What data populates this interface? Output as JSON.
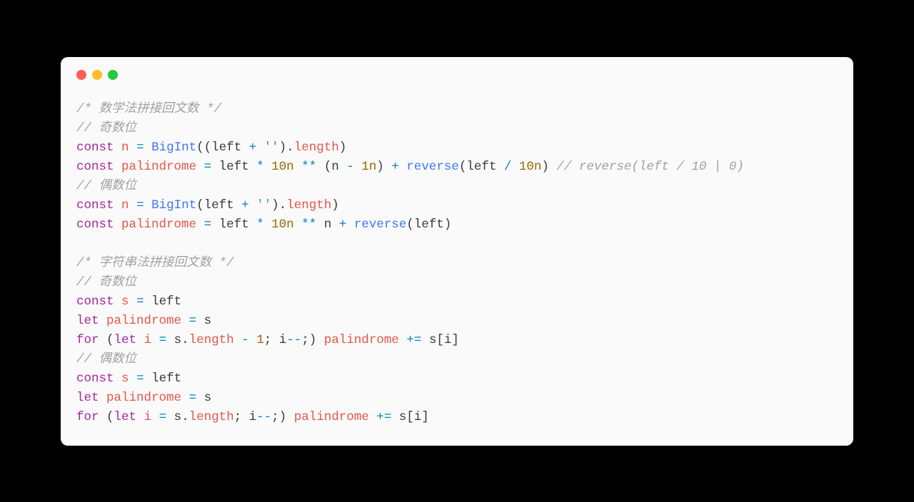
{
  "window": {
    "traffic_lights": [
      "red",
      "yellow",
      "green"
    ]
  },
  "code": {
    "lines": [
      [
        {
          "cls": "tok-comment",
          "t": "/* 数学法拼接回文数 */"
        }
      ],
      [
        {
          "cls": "tok-comment",
          "t": "// 奇数位"
        }
      ],
      [
        {
          "cls": "tok-keyword",
          "t": "const"
        },
        {
          "cls": "tok-plain",
          "t": " "
        },
        {
          "cls": "tok-var",
          "t": "n"
        },
        {
          "cls": "tok-plain",
          "t": " "
        },
        {
          "cls": "tok-op",
          "t": "="
        },
        {
          "cls": "tok-plain",
          "t": " "
        },
        {
          "cls": "tok-func",
          "t": "BigInt"
        },
        {
          "cls": "tok-plain",
          "t": "((left "
        },
        {
          "cls": "tok-op",
          "t": "+"
        },
        {
          "cls": "tok-plain",
          "t": " "
        },
        {
          "cls": "tok-string",
          "t": "''"
        },
        {
          "cls": "tok-plain",
          "t": ")."
        },
        {
          "cls": "tok-prop",
          "t": "length"
        },
        {
          "cls": "tok-plain",
          "t": ")"
        }
      ],
      [
        {
          "cls": "tok-keyword",
          "t": "const"
        },
        {
          "cls": "tok-plain",
          "t": " "
        },
        {
          "cls": "tok-var",
          "t": "palindrome"
        },
        {
          "cls": "tok-plain",
          "t": " "
        },
        {
          "cls": "tok-op",
          "t": "="
        },
        {
          "cls": "tok-plain",
          "t": " left "
        },
        {
          "cls": "tok-op",
          "t": "*"
        },
        {
          "cls": "tok-plain",
          "t": " "
        },
        {
          "cls": "tok-num",
          "t": "10n"
        },
        {
          "cls": "tok-plain",
          "t": " "
        },
        {
          "cls": "tok-op",
          "t": "**"
        },
        {
          "cls": "tok-plain",
          "t": " (n "
        },
        {
          "cls": "tok-op",
          "t": "-"
        },
        {
          "cls": "tok-plain",
          "t": " "
        },
        {
          "cls": "tok-num",
          "t": "1n"
        },
        {
          "cls": "tok-plain",
          "t": ") "
        },
        {
          "cls": "tok-op",
          "t": "+"
        },
        {
          "cls": "tok-plain",
          "t": " "
        },
        {
          "cls": "tok-func",
          "t": "reverse"
        },
        {
          "cls": "tok-plain",
          "t": "(left "
        },
        {
          "cls": "tok-op",
          "t": "/"
        },
        {
          "cls": "tok-plain",
          "t": " "
        },
        {
          "cls": "tok-num",
          "t": "10n"
        },
        {
          "cls": "tok-plain",
          "t": ") "
        },
        {
          "cls": "tok-comment",
          "t": "// reverse(left / 10 | 0)"
        }
      ],
      [
        {
          "cls": "tok-comment",
          "t": "// 偶数位"
        }
      ],
      [
        {
          "cls": "tok-keyword",
          "t": "const"
        },
        {
          "cls": "tok-plain",
          "t": " "
        },
        {
          "cls": "tok-var",
          "t": "n"
        },
        {
          "cls": "tok-plain",
          "t": " "
        },
        {
          "cls": "tok-op",
          "t": "="
        },
        {
          "cls": "tok-plain",
          "t": " "
        },
        {
          "cls": "tok-func",
          "t": "BigInt"
        },
        {
          "cls": "tok-plain",
          "t": "(left "
        },
        {
          "cls": "tok-op",
          "t": "+"
        },
        {
          "cls": "tok-plain",
          "t": " "
        },
        {
          "cls": "tok-string",
          "t": "''"
        },
        {
          "cls": "tok-plain",
          "t": ")."
        },
        {
          "cls": "tok-prop",
          "t": "length"
        },
        {
          "cls": "tok-plain",
          "t": ")"
        }
      ],
      [
        {
          "cls": "tok-keyword",
          "t": "const"
        },
        {
          "cls": "tok-plain",
          "t": " "
        },
        {
          "cls": "tok-var",
          "t": "palindrome"
        },
        {
          "cls": "tok-plain",
          "t": " "
        },
        {
          "cls": "tok-op",
          "t": "="
        },
        {
          "cls": "tok-plain",
          "t": " left "
        },
        {
          "cls": "tok-op",
          "t": "*"
        },
        {
          "cls": "tok-plain",
          "t": " "
        },
        {
          "cls": "tok-num",
          "t": "10n"
        },
        {
          "cls": "tok-plain",
          "t": " "
        },
        {
          "cls": "tok-op",
          "t": "**"
        },
        {
          "cls": "tok-plain",
          "t": " n "
        },
        {
          "cls": "tok-op",
          "t": "+"
        },
        {
          "cls": "tok-plain",
          "t": " "
        },
        {
          "cls": "tok-func",
          "t": "reverse"
        },
        {
          "cls": "tok-plain",
          "t": "(left)"
        }
      ],
      [
        {
          "cls": "tok-plain",
          "t": ""
        }
      ],
      [
        {
          "cls": "tok-comment",
          "t": "/* 字符串法拼接回文数 */"
        }
      ],
      [
        {
          "cls": "tok-comment",
          "t": "// 奇数位"
        }
      ],
      [
        {
          "cls": "tok-keyword",
          "t": "const"
        },
        {
          "cls": "tok-plain",
          "t": " "
        },
        {
          "cls": "tok-var",
          "t": "s"
        },
        {
          "cls": "tok-plain",
          "t": " "
        },
        {
          "cls": "tok-op",
          "t": "="
        },
        {
          "cls": "tok-plain",
          "t": " left"
        }
      ],
      [
        {
          "cls": "tok-keyword",
          "t": "let"
        },
        {
          "cls": "tok-plain",
          "t": " "
        },
        {
          "cls": "tok-var",
          "t": "palindrome"
        },
        {
          "cls": "tok-plain",
          "t": " "
        },
        {
          "cls": "tok-op",
          "t": "="
        },
        {
          "cls": "tok-plain",
          "t": " s"
        }
      ],
      [
        {
          "cls": "tok-keyword",
          "t": "for"
        },
        {
          "cls": "tok-plain",
          "t": " ("
        },
        {
          "cls": "tok-keyword",
          "t": "let"
        },
        {
          "cls": "tok-plain",
          "t": " "
        },
        {
          "cls": "tok-var",
          "t": "i"
        },
        {
          "cls": "tok-plain",
          "t": " "
        },
        {
          "cls": "tok-op",
          "t": "="
        },
        {
          "cls": "tok-plain",
          "t": " s."
        },
        {
          "cls": "tok-prop",
          "t": "length"
        },
        {
          "cls": "tok-plain",
          "t": " "
        },
        {
          "cls": "tok-op",
          "t": "-"
        },
        {
          "cls": "tok-plain",
          "t": " "
        },
        {
          "cls": "tok-num",
          "t": "1"
        },
        {
          "cls": "tok-plain",
          "t": "; i"
        },
        {
          "cls": "tok-op",
          "t": "--"
        },
        {
          "cls": "tok-plain",
          "t": ";) "
        },
        {
          "cls": "tok-var",
          "t": "palindrome"
        },
        {
          "cls": "tok-plain",
          "t": " "
        },
        {
          "cls": "tok-op",
          "t": "+="
        },
        {
          "cls": "tok-plain",
          "t": " s[i]"
        }
      ],
      [
        {
          "cls": "tok-comment",
          "t": "// 偶数位"
        }
      ],
      [
        {
          "cls": "tok-keyword",
          "t": "const"
        },
        {
          "cls": "tok-plain",
          "t": " "
        },
        {
          "cls": "tok-var",
          "t": "s"
        },
        {
          "cls": "tok-plain",
          "t": " "
        },
        {
          "cls": "tok-op",
          "t": "="
        },
        {
          "cls": "tok-plain",
          "t": " left"
        }
      ],
      [
        {
          "cls": "tok-keyword",
          "t": "let"
        },
        {
          "cls": "tok-plain",
          "t": " "
        },
        {
          "cls": "tok-var",
          "t": "palindrome"
        },
        {
          "cls": "tok-plain",
          "t": " "
        },
        {
          "cls": "tok-op",
          "t": "="
        },
        {
          "cls": "tok-plain",
          "t": " s"
        }
      ],
      [
        {
          "cls": "tok-keyword",
          "t": "for"
        },
        {
          "cls": "tok-plain",
          "t": " ("
        },
        {
          "cls": "tok-keyword",
          "t": "let"
        },
        {
          "cls": "tok-plain",
          "t": " "
        },
        {
          "cls": "tok-var",
          "t": "i"
        },
        {
          "cls": "tok-plain",
          "t": " "
        },
        {
          "cls": "tok-op",
          "t": "="
        },
        {
          "cls": "tok-plain",
          "t": " s."
        },
        {
          "cls": "tok-prop",
          "t": "length"
        },
        {
          "cls": "tok-plain",
          "t": "; i"
        },
        {
          "cls": "tok-op",
          "t": "--"
        },
        {
          "cls": "tok-plain",
          "t": ";) "
        },
        {
          "cls": "tok-var",
          "t": "palindrome"
        },
        {
          "cls": "tok-plain",
          "t": " "
        },
        {
          "cls": "tok-op",
          "t": "+="
        },
        {
          "cls": "tok-plain",
          "t": " s[i]"
        }
      ]
    ]
  }
}
